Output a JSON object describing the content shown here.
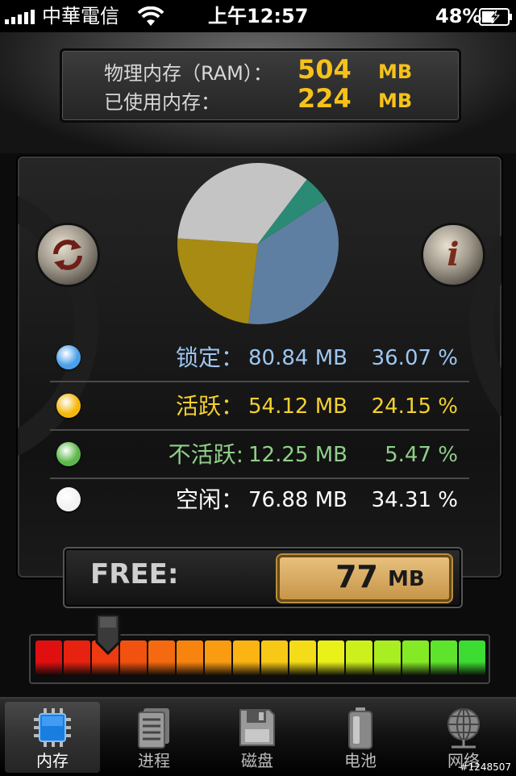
{
  "status_bar": {
    "carrier": "中華電信",
    "time": "上午12:57",
    "battery": "48%",
    "icons": [
      "signal-bars-icon",
      "wifi-icon",
      "battery-charging-icon"
    ]
  },
  "ram": {
    "physical_label": "物理内存（RAM）：",
    "physical_value": "504",
    "physical_unit": "MB",
    "used_label": "已使用内存：",
    "used_value": "224",
    "used_unit": "MB"
  },
  "buttons": {
    "refresh_icon": "refresh-icon",
    "info_icon": "info-icon"
  },
  "chart_data": {
    "type": "pie",
    "slices": [
      {
        "label": "锁定",
        "value": 36.07,
        "color": "#5f7fa2"
      },
      {
        "label": "活跃",
        "value": 24.15,
        "color": "#a88b12"
      },
      {
        "label": "空闲",
        "value": 34.31,
        "color": "#c4c4c4"
      },
      {
        "label": "不活跃",
        "value": 5.47,
        "color": "#2a8a73"
      }
    ]
  },
  "legend": [
    {
      "label": "锁定：",
      "size": "80.84 MB",
      "pct": "36.07 %",
      "color": "#9dc6f2",
      "dot": "#4aa0ea"
    },
    {
      "label": "活跃：",
      "size": "54.12 MB",
      "pct": "24.15 %",
      "color": "#f3d12e",
      "dot": "#f4b80a"
    },
    {
      "label": "不活跃:",
      "size": "12.25 MB",
      "pct": "5.47 %",
      "color": "#8fcf88",
      "dot": "#5cb84a"
    },
    {
      "label": "空闲：",
      "size": "76.88 MB",
      "pct": "34.31 %",
      "color": "#ffffff",
      "dot": "#f2f2f2"
    }
  ],
  "free": {
    "label": "FREE:",
    "value": "77",
    "unit": "MB"
  },
  "gauge": {
    "level": 0.15,
    "colors": [
      "#e01010",
      "#e82210",
      "#ee3a10",
      "#f25210",
      "#f56a10",
      "#f88410",
      "#fa9c12",
      "#fbb414",
      "#f8c816",
      "#f4dc18",
      "#eaf01a",
      "#ccf01c",
      "#a8ee20",
      "#84ea26",
      "#5ee42c",
      "#3cdc32"
    ]
  },
  "tabs": [
    {
      "label": "内存",
      "icon": "chip-icon",
      "active": true
    },
    {
      "label": "进程",
      "icon": "document-stack-icon",
      "active": false
    },
    {
      "label": "磁盘",
      "icon": "floppy-disk-icon",
      "active": false
    },
    {
      "label": "电池",
      "icon": "battery-icon",
      "active": false
    },
    {
      "label": "网络",
      "icon": "globe-icon",
      "active": false
    }
  ],
  "watermark": "#1248507"
}
